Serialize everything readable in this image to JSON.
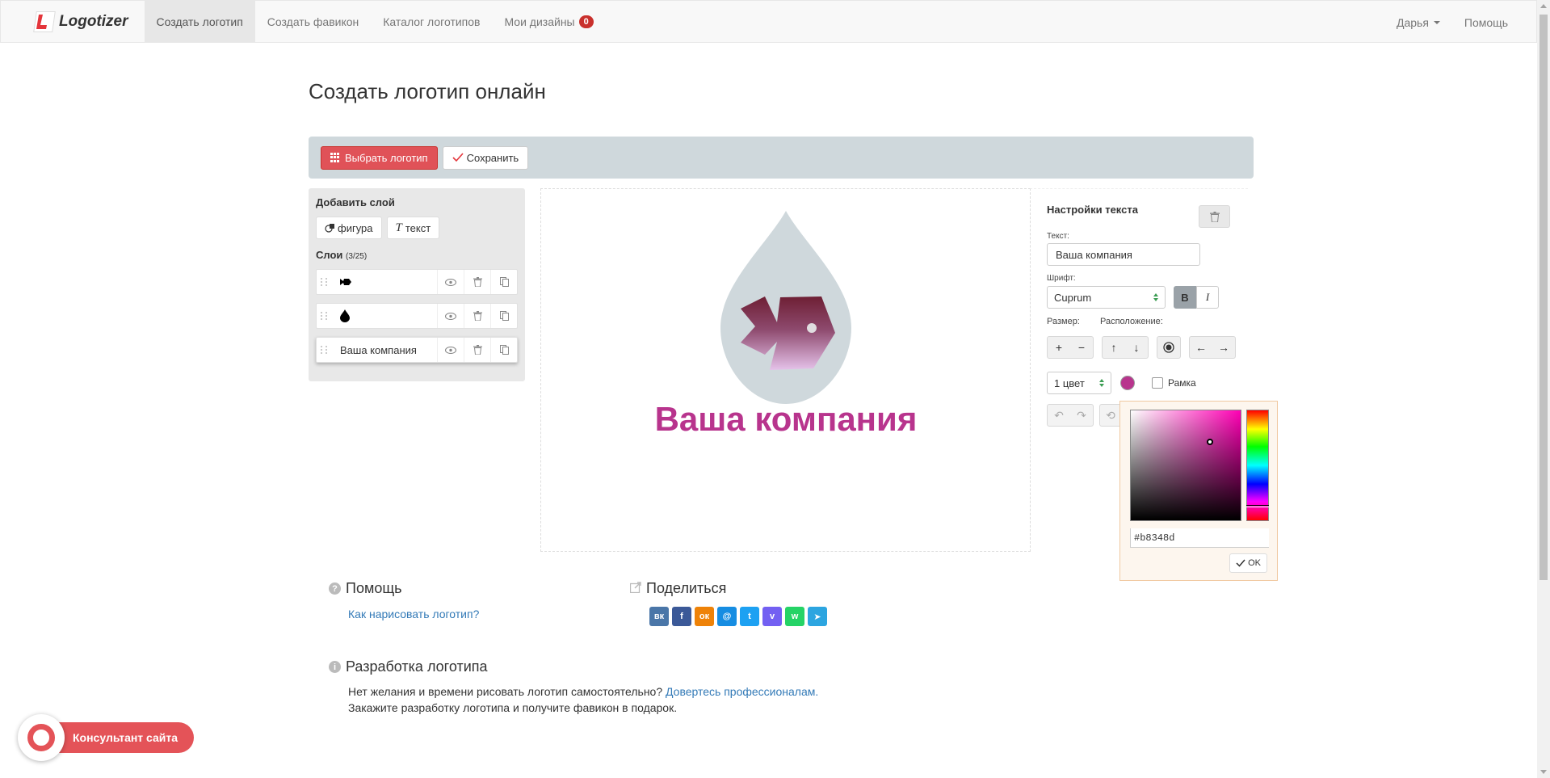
{
  "brand": {
    "name": "Logotizer"
  },
  "nav": {
    "items": [
      {
        "label": "Создать логотип"
      },
      {
        "label": "Создать фавикон"
      },
      {
        "label": "Каталог логотипов"
      },
      {
        "label": "Мои дизайны",
        "badge": "0"
      }
    ],
    "user": "Дарья",
    "help": "Помощь"
  },
  "page": {
    "title": "Создать логотип онлайн"
  },
  "toolbar": {
    "choose_label": "Выбрать логотип",
    "save_label": "Сохранить"
  },
  "layers_panel": {
    "add_title": "Добавить слой",
    "add_shape": "фигура",
    "add_text": "текст",
    "layers_title": "Слои",
    "layers_count": "(3/25)",
    "layers": [
      {
        "type": "fish-icon"
      },
      {
        "type": "drop-icon"
      },
      {
        "type": "text",
        "label": "Ваша компания"
      }
    ]
  },
  "canvas": {
    "company_text": "Ваша компания"
  },
  "text_settings": {
    "title": "Настройки текста",
    "text_label": "Текст:",
    "text_value": "Ваша компания",
    "font_label": "Шрифт:",
    "font_value": "Cuprum",
    "bold": "B",
    "italic": "I",
    "size_label": "Размер:",
    "position_label": "Расположение:",
    "color_mode": "1 цвет",
    "frame_label": "Рамка",
    "color": "#b8348d"
  },
  "color_picker": {
    "hex_value": "#b8348d",
    "ok_label": "OK"
  },
  "help_section": {
    "title": "Помощь",
    "link": "Как нарисовать логотип?"
  },
  "share_section": {
    "title": "Поделиться",
    "networks": [
      {
        "name": "vk",
        "glyph": "вк",
        "color": "#4a76a8"
      },
      {
        "name": "facebook",
        "glyph": "f",
        "color": "#3b5998"
      },
      {
        "name": "odnoklassniki",
        "glyph": "ок",
        "color": "#ee8208"
      },
      {
        "name": "moimir",
        "glyph": "@",
        "color": "#168de2"
      },
      {
        "name": "twitter",
        "glyph": "t",
        "color": "#1da1f2"
      },
      {
        "name": "viber",
        "glyph": "v",
        "color": "#7360f2"
      },
      {
        "name": "whatsapp",
        "glyph": "w",
        "color": "#25d366"
      },
      {
        "name": "telegram",
        "glyph": "➤",
        "color": "#2ca5e0"
      }
    ]
  },
  "dev_section": {
    "title": "Разработка логотипа",
    "line1": "Нет желания и времени рисовать логотип самостоятельно?",
    "link": "Довертесь профессионалам.",
    "line2": "Закажите разработку логотипа и получите фавикон в подарок."
  },
  "consultant": {
    "label": "Консультант сайта"
  }
}
